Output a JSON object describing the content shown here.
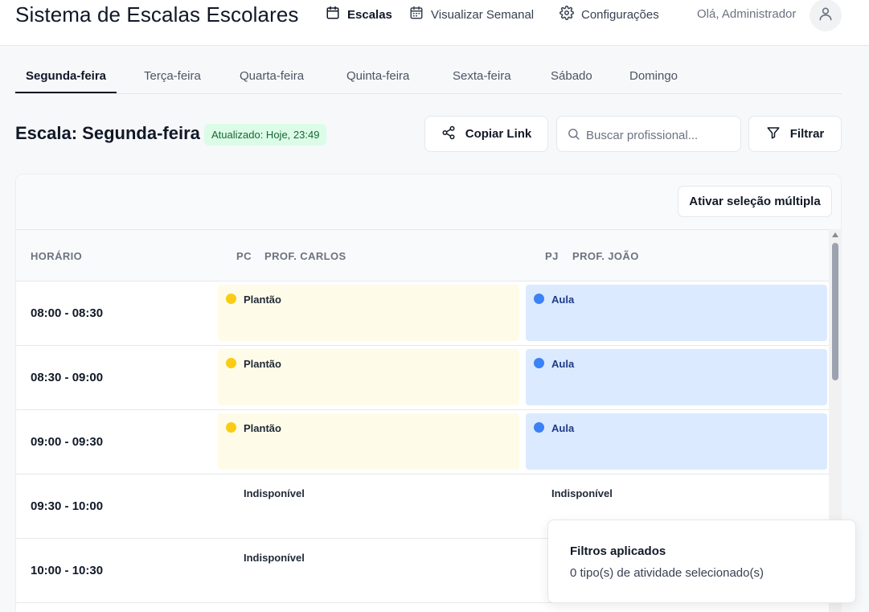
{
  "header": {
    "app_title": "Sistema de Escalas Escolares",
    "nav": [
      {
        "label": "Escalas",
        "icon": "calendar-icon"
      },
      {
        "label": "Visualizar Semanal",
        "icon": "calendar-week-icon"
      },
      {
        "label": "Configurações",
        "icon": "gear-icon"
      }
    ],
    "greeting": "Olá, Administrador",
    "avatar_icon": "user-icon"
  },
  "tabs": [
    "Segunda-feira",
    "Terça-feira",
    "Quarta-feira",
    "Quinta-feira",
    "Sexta-feira",
    "Sábado",
    "Domingo"
  ],
  "active_tab": "Segunda-feira",
  "schedule": {
    "title": "Escala: Segunda-feira",
    "updated_badge": "Atualizado: Hoje, 23:49",
    "copy_link_label": "Copiar Link",
    "search_placeholder": "Buscar profissional...",
    "filter_label": "Filtrar",
    "multi_select_label": "Ativar seleção múltipla"
  },
  "table": {
    "time_header": "HORÁRIO",
    "professionals": [
      {
        "initials": "PC",
        "name": "PROF. CARLOS"
      },
      {
        "initials": "PJ",
        "name": "PROF. JOÃO"
      }
    ],
    "rows": [
      {
        "time": "08:00 - 08:30",
        "slots": [
          {
            "label": "Plantão",
            "kind": "yellow"
          },
          {
            "label": "Aula",
            "kind": "blue"
          }
        ]
      },
      {
        "time": "08:30 - 09:00",
        "slots": [
          {
            "label": "Plantão",
            "kind": "yellow"
          },
          {
            "label": "Aula",
            "kind": "blue"
          }
        ]
      },
      {
        "time": "09:00 - 09:30",
        "slots": [
          {
            "label": "Plantão",
            "kind": "yellow"
          },
          {
            "label": "Aula",
            "kind": "blue"
          }
        ]
      },
      {
        "time": "09:30 - 10:00",
        "slots": [
          {
            "label": "Indisponível",
            "kind": "none"
          },
          {
            "label": "Indisponível",
            "kind": "none"
          }
        ]
      },
      {
        "time": "10:00 - 10:30",
        "slots": [
          {
            "label": "Indisponível",
            "kind": "none"
          },
          {
            "label": "",
            "kind": "none"
          }
        ]
      }
    ]
  },
  "toast": {
    "title": "Filtros aplicados",
    "message": "0 tipo(s) de atividade selecionado(s)"
  },
  "colors": {
    "plantao": "#fefce8",
    "plantao_dot": "#facc15",
    "aula": "#dbeafe",
    "aula_dot": "#3b82f6",
    "badge_bg": "#dcfce7",
    "badge_text": "#166534"
  }
}
